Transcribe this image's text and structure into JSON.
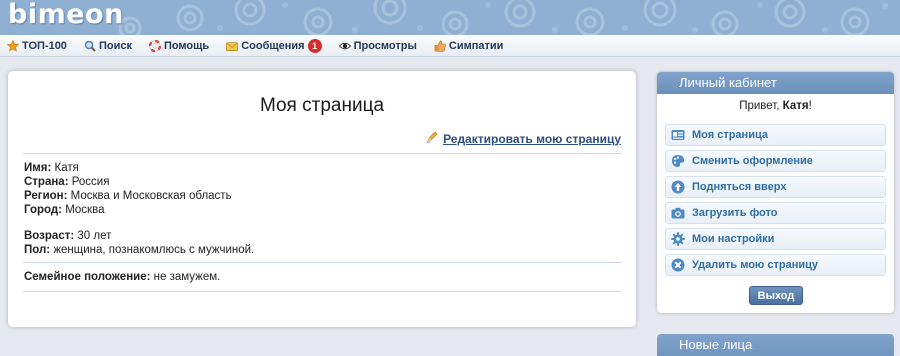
{
  "header": {
    "logo": "bimeon"
  },
  "nav": [
    {
      "label": "ТОП-100",
      "icon": "star-icon"
    },
    {
      "label": "Поиск",
      "icon": "magnifier-icon"
    },
    {
      "label": "Помощь",
      "icon": "lifebuoy-icon"
    },
    {
      "label": "Сообщения",
      "icon": "envelope-icon",
      "badge": "1"
    },
    {
      "label": "Просмотры",
      "icon": "eye-icon"
    },
    {
      "label": "Симпатии",
      "icon": "thumbs-up-icon"
    }
  ],
  "main": {
    "title": "Моя страница",
    "edit_link": "Редактировать мою страницу",
    "fields": {
      "name_label": "Имя:",
      "name_value": "Катя",
      "country_label": "Страна:",
      "country_value": "Россия",
      "region_label": "Регион:",
      "region_value": "Москва и Московская область",
      "city_label": "Город:",
      "city_value": "Москва",
      "age_label": "Возраст:",
      "age_value": "30 лет",
      "gender_label": "Пол:",
      "gender_value": "женщина, познакомлюсь с мужчиной.",
      "marital_label": "Семейное положение:",
      "marital_value": "не замужем."
    }
  },
  "sidebar": {
    "title": "Личный кабинет",
    "greeting_prefix": "Привет, ",
    "greeting_name": "Катя",
    "greeting_suffix": "!",
    "menu": [
      {
        "label": "Моя страница",
        "icon": "profile-card-icon"
      },
      {
        "label": "Сменить оформление",
        "icon": "palette-icon"
      },
      {
        "label": "Подняться вверх",
        "icon": "arrow-up-circle-icon"
      },
      {
        "label": "Загрузить фото",
        "icon": "camera-icon"
      },
      {
        "label": "Мои настройки",
        "icon": "gear-icon"
      },
      {
        "label": "Удалить мою страницу",
        "icon": "delete-circle-icon"
      }
    ],
    "logout": "Выход",
    "next_section_title": "Новые лица"
  },
  "colors": {
    "banner": "#8fb0d3",
    "link": "#2e6ea6",
    "badge": "#d62d2d",
    "panel_header": "#7fa3cb"
  }
}
